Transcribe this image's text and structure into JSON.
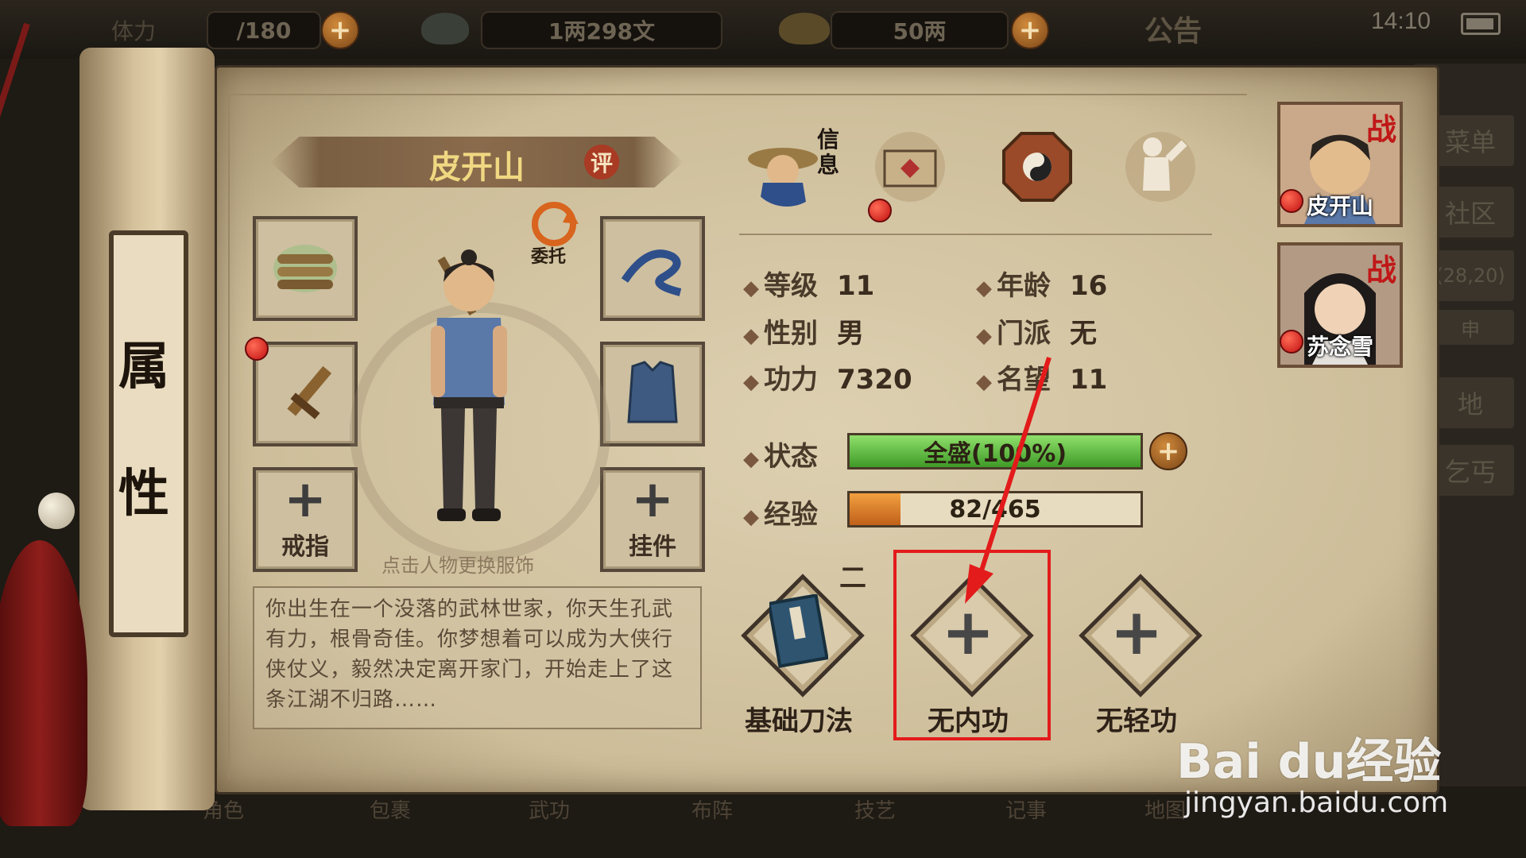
{
  "topbar": {
    "stamina_label": "体力",
    "stamina_value": "/180",
    "money_value": "1两298文",
    "gold_value": "50两",
    "notice_label": "公告",
    "clock": "14:10"
  },
  "right_menu": [
    "菜单",
    "社区",
    "(28,20)",
    "申",
    "地",
    "乞丐"
  ],
  "bottom_nav": [
    "角色",
    "包裹",
    "武功",
    "布阵",
    "技艺",
    "记事",
    "地图"
  ],
  "scroll_tab": {
    "char1": "属",
    "char2": "性"
  },
  "character": {
    "name": "皮开山",
    "rate_button": "评",
    "delegate_label": "委托",
    "hint": "点击人物更换服饰",
    "story": "你出生在一个没落的武林世家，你天生孔武有力，根骨奇佳。你梦想着可以成为大侠行侠仗义，毅然决定离开家门，开始走上了这条江湖不归路……"
  },
  "equipment": {
    "ring_label": "戒指",
    "pendant_label": "挂件"
  },
  "tabs": {
    "info_label": "信息"
  },
  "stats": {
    "level_label": "等级",
    "level_value": "11",
    "age_label": "年龄",
    "age_value": "16",
    "gender_label": "性别",
    "gender_value": "男",
    "sect_label": "门派",
    "sect_value": "无",
    "power_label": "功力",
    "power_value": "7320",
    "fame_label": "名望",
    "fame_value": "11",
    "status_label": "状态",
    "status_value": "全盛(100%)",
    "status_fraction": 1.0,
    "exp_label": "经验",
    "exp_value": "82/465",
    "exp_fraction": 0.176
  },
  "skills": {
    "number_mark": "二",
    "basic": "基础刀法",
    "internal": "无内功",
    "lightness": "无轻功"
  },
  "party": [
    {
      "name": "皮开山",
      "tag": "战"
    },
    {
      "name": "苏念雪",
      "tag": "战"
    }
  ],
  "watermark": {
    "logo": "Bai du经验",
    "url": "jingyan.baidu.com"
  },
  "colors": {
    "accent_red": "#e31b1b",
    "status_green": "#5fbf3a",
    "exp_orange": "#e07a20"
  }
}
